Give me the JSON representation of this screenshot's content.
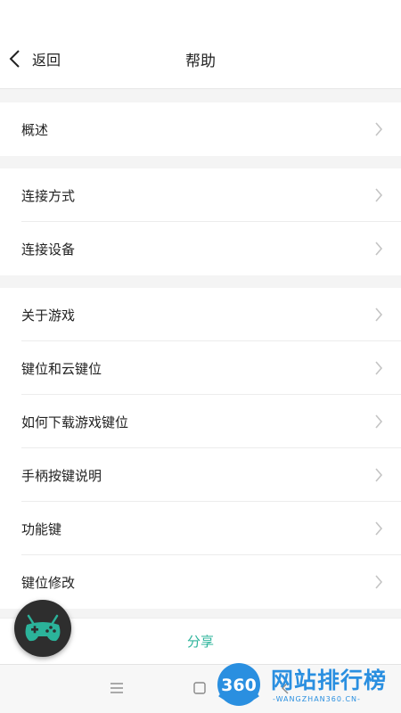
{
  "header": {
    "back_label": "返回",
    "title": "帮助"
  },
  "groups": [
    {
      "items": [
        {
          "label": "概述"
        }
      ]
    },
    {
      "items": [
        {
          "label": "连接方式"
        },
        {
          "label": "连接设备"
        }
      ]
    },
    {
      "items": [
        {
          "label": "关于游戏"
        },
        {
          "label": "键位和云键位"
        },
        {
          "label": "如何下载游戏键位"
        },
        {
          "label": "手柄按键说明"
        },
        {
          "label": "功能键"
        },
        {
          "label": "键位修改"
        }
      ]
    }
  ],
  "share": {
    "label": "分享"
  },
  "floating_button": {
    "icon": "gamepad-icon",
    "color": "#2bb39a"
  },
  "watermark": {
    "logo_text": "360",
    "text": "网站排行榜",
    "subtext": "-WANGZHAN360.CN-"
  },
  "colors": {
    "accent": "#2bb39a",
    "watermark_blue": "#2a8fe0"
  }
}
